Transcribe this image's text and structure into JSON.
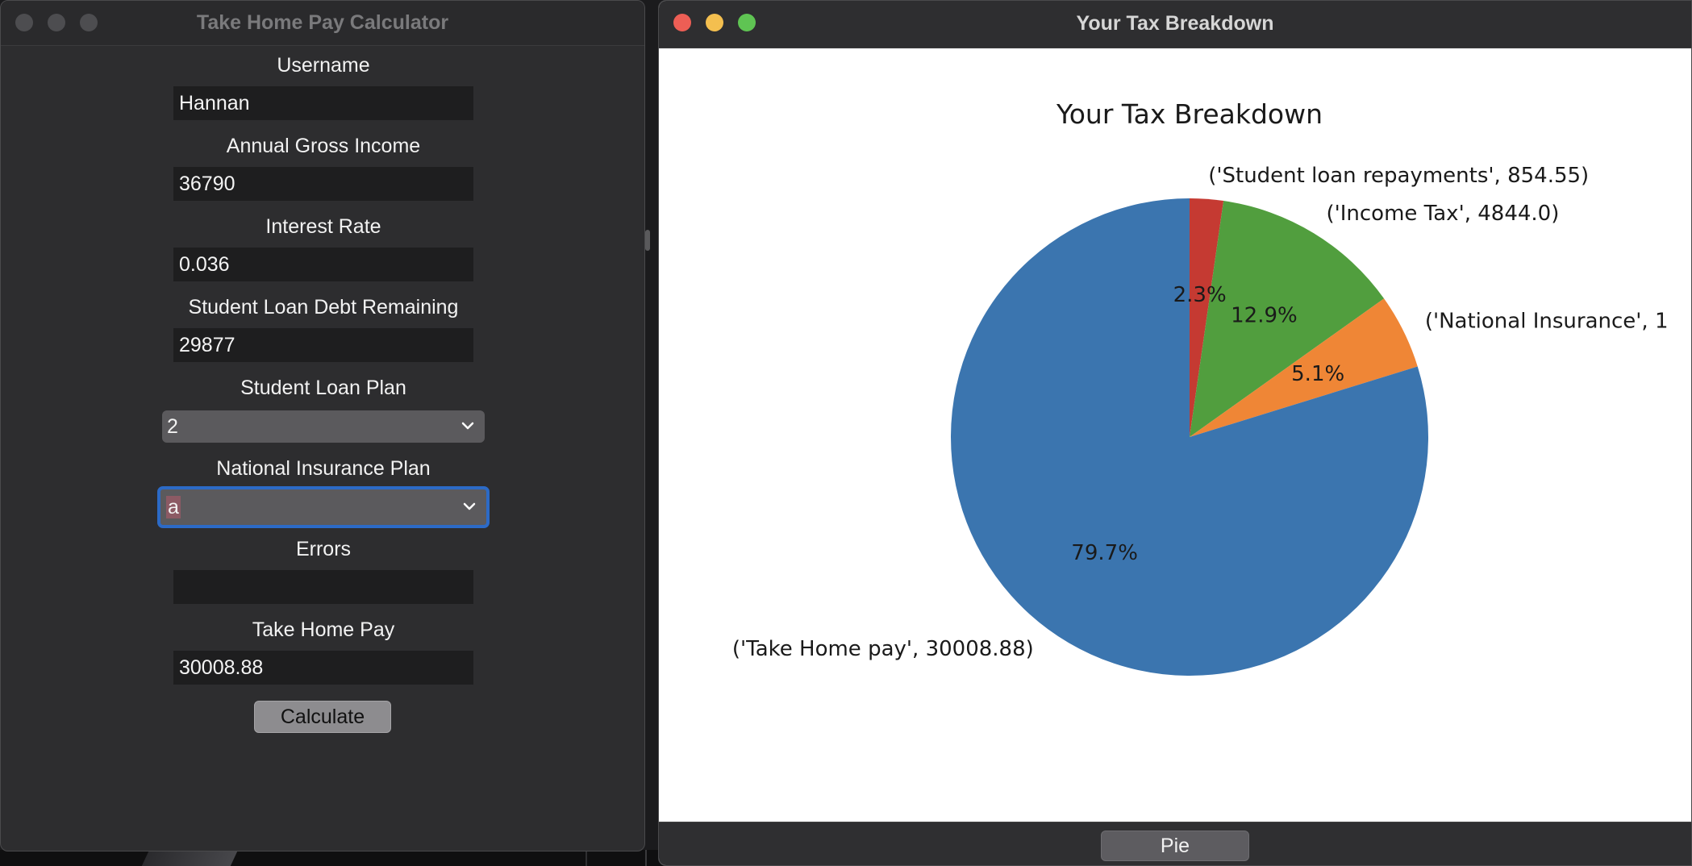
{
  "calculator_window": {
    "title": "Take Home Pay Calculator",
    "fields": {
      "username": {
        "label": "Username",
        "value": "Hannan"
      },
      "gross_income": {
        "label": "Annual Gross Income",
        "value": "36790"
      },
      "interest_rate": {
        "label": "Interest Rate",
        "value": "0.036"
      },
      "loan_debt": {
        "label": "Student Loan Debt Remaining",
        "value": "29877"
      },
      "loan_plan": {
        "label": "Student Loan Plan",
        "value": "2"
      },
      "ni_plan": {
        "label": "National Insurance Plan",
        "value": "a"
      },
      "errors": {
        "label": "Errors",
        "value": ""
      },
      "take_home": {
        "label": "Take Home Pay",
        "value": "30008.88"
      }
    },
    "calculate_label": "Calculate"
  },
  "chart_window": {
    "title": "Your Tax Breakdown",
    "button_label": "Pie"
  },
  "colors": {
    "take_home": "#3b75af",
    "national_insurance": "#ef8636",
    "income_tax": "#519e3e",
    "student_loan": "#c53a32"
  },
  "chart_data": {
    "type": "pie",
    "title": "Your Tax Breakdown",
    "start_angle_deg": 90,
    "slices": [
      {
        "label": "('Student loan repayments', 854.55)",
        "value": 854.55,
        "pct_label": "2.3%",
        "color": "#c53a32"
      },
      {
        "label": "('Income Tax', 4844.0)",
        "value": 4844.0,
        "pct_label": "12.9%",
        "color": "#519e3e"
      },
      {
        "label": "('National Insurance', 1",
        "value": 1908.0,
        "pct_label": "5.1%",
        "color": "#ef8636"
      },
      {
        "label": "('Take Home pay', 30008.88)",
        "value": 30008.88,
        "pct_label": "79.7%",
        "color": "#3b75af"
      }
    ]
  }
}
